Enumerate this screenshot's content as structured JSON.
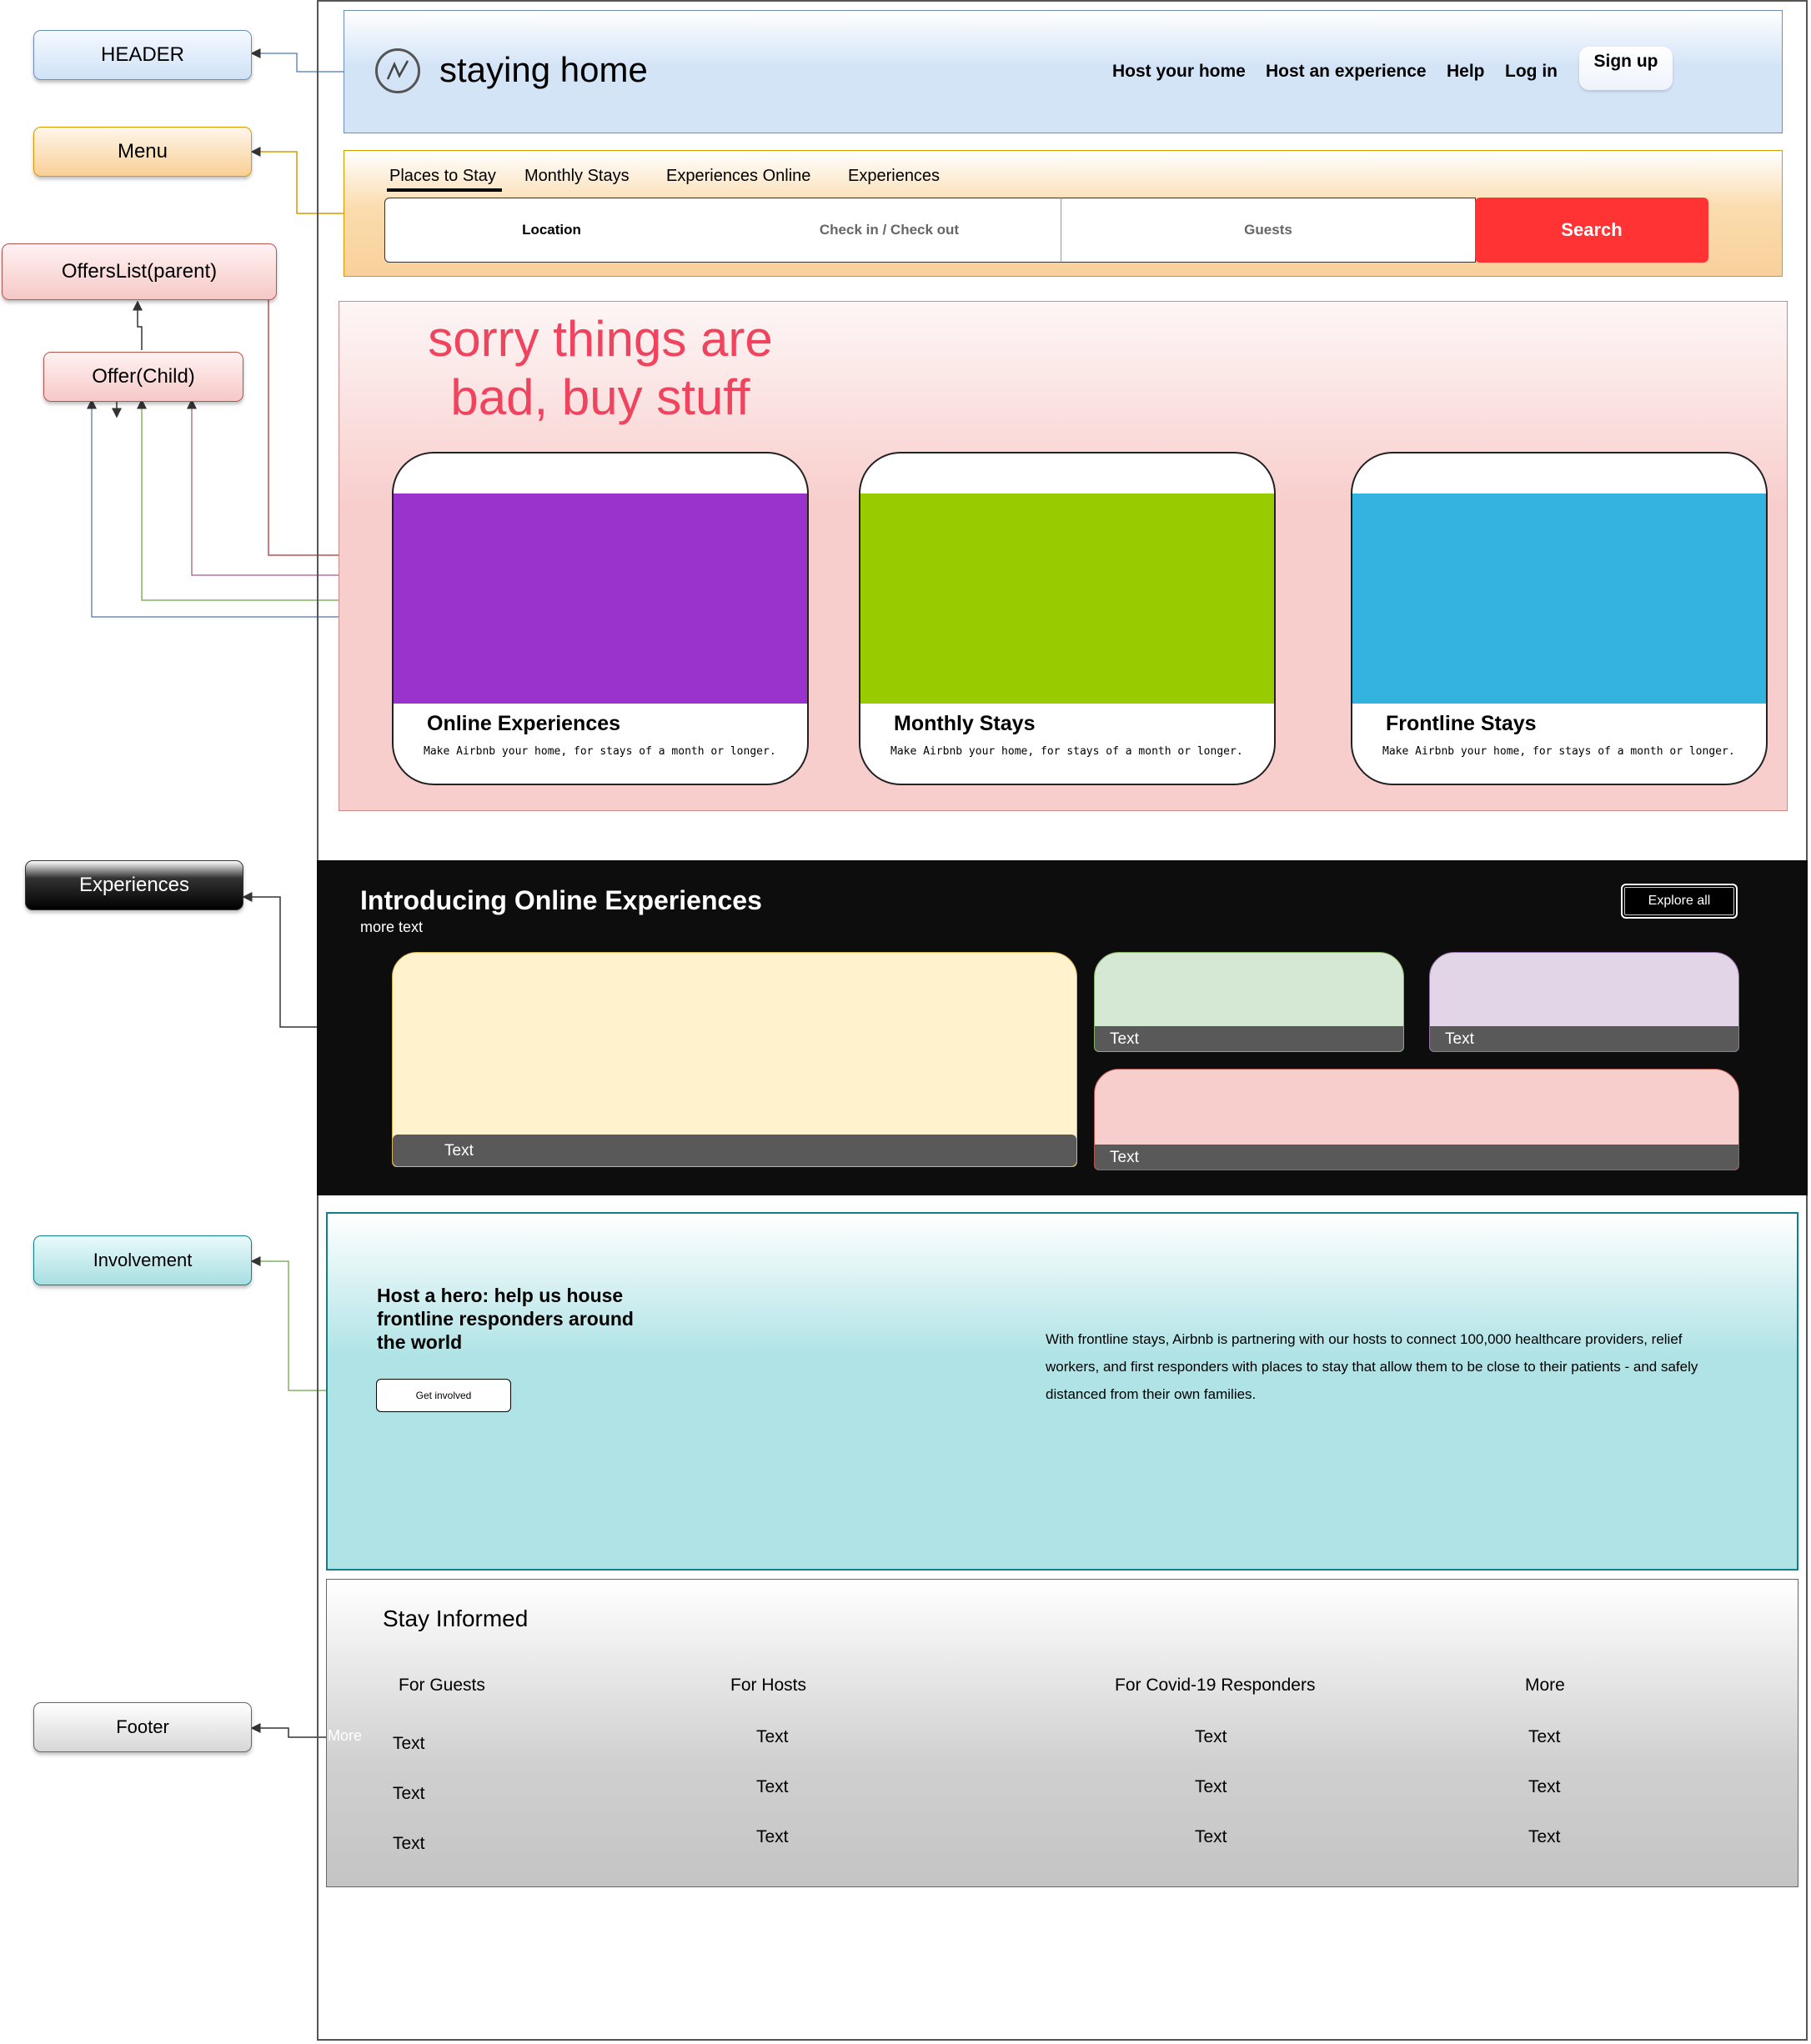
{
  "labels": {
    "header": "HEADER",
    "menu": "Menu",
    "offers_parent": "OffersList(parent)",
    "offer_child": "Offer(Child)",
    "experiences": "Experiences",
    "involvement": "Involvement",
    "footer": "Footer"
  },
  "header": {
    "brand": "staying home",
    "nav": [
      "Host your home",
      "Host an experience",
      "Help",
      "Log in"
    ],
    "signup": "Sign up"
  },
  "menu": {
    "tabs": [
      "Places to Stay",
      "Monthly Stays",
      "Experiences Online",
      "Experiences"
    ],
    "active_tab": "Places to Stay",
    "search": {
      "location": "Location",
      "dates": "Check in / Check out",
      "guests": "Guests",
      "button": "Search"
    }
  },
  "offers": {
    "headline_line1": "sorry things are",
    "headline_line2": "bad, buy stuff",
    "cards": [
      {
        "title": "Online Experiences",
        "desc": "Make Airbnb your home, for stays of a month or longer.",
        "color": "#9933cc"
      },
      {
        "title": "Monthly Stays",
        "desc": "Make Airbnb your home, for stays of a month or longer.",
        "color": "#99cc00"
      },
      {
        "title": "Frontline Stays",
        "desc": "Make Airbnb your home, for stays of a month or longer.",
        "color": "#33b3e0"
      }
    ]
  },
  "experiences": {
    "title": "Introducing Online Experiences",
    "subtitle": "more text",
    "explore": "Explore all",
    "tiles": [
      {
        "label": "Text",
        "color": "#fff2cc"
      },
      {
        "label": "Text",
        "color": "#d5e8d4"
      },
      {
        "label": "Text",
        "color": "#e1d5e7"
      },
      {
        "label": "Text",
        "color": "#f8cecc"
      }
    ]
  },
  "involvement": {
    "title": "Host a hero: help us house frontline responders around the world",
    "button": "Get involved",
    "text": "With frontline stays, Airbnb is partnering with our hosts to connect 100,000 healthcare providers, relief workers, and first responders with places to stay that allow them to be close to their patients - and safely distanced from their own families."
  },
  "footer": {
    "title": "Stay Informed",
    "overlay_label": "More",
    "columns": [
      {
        "heading": "For Guests",
        "items": [
          "Text",
          "Text",
          "Text"
        ]
      },
      {
        "heading": "For Hosts",
        "items": [
          "Text",
          "Text",
          "Text"
        ]
      },
      {
        "heading": "For Covid-19 Responders",
        "items": [
          "Text",
          "Text",
          "Text"
        ]
      },
      {
        "heading": "More",
        "items": [
          "Text",
          "Text",
          "Text"
        ]
      }
    ]
  },
  "colors": {
    "header_fill": "#dae8fc",
    "menu_fill": "#ffe6cc",
    "offers_fill": "#f8cecc",
    "involvement_fill": "#b0e3e6",
    "footer_fill": "#c4c4c4",
    "search_button": "#ff3333",
    "headline": "#f0435e"
  }
}
